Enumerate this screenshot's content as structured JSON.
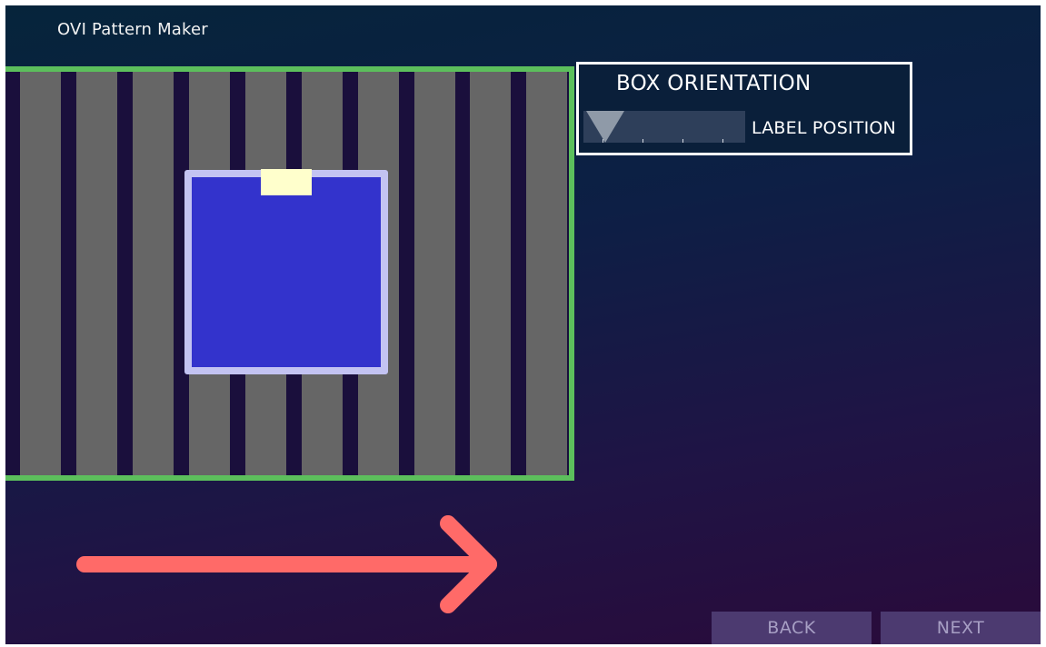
{
  "app": {
    "title": "OVI Pattern Maker"
  },
  "orientation_panel": {
    "title": "BOX ORIENTATION",
    "label_position_text": "LABEL POSITION",
    "slider": {
      "positions": 4,
      "selected_index": 0
    }
  },
  "navigation": {
    "back_label": "BACK",
    "next_label": "NEXT"
  },
  "conveyor": {
    "roller_count": 10
  },
  "icons": {
    "direction": "arrow-right-icon"
  },
  "colors": {
    "conveyor_border": "#5cbf5c",
    "roller": "#666666",
    "box_fill": "#3333cc",
    "box_border": "#c3c3f2",
    "label": "#ffffcc",
    "arrow": "#ff6a68",
    "button_bg": "#4c3a70"
  }
}
